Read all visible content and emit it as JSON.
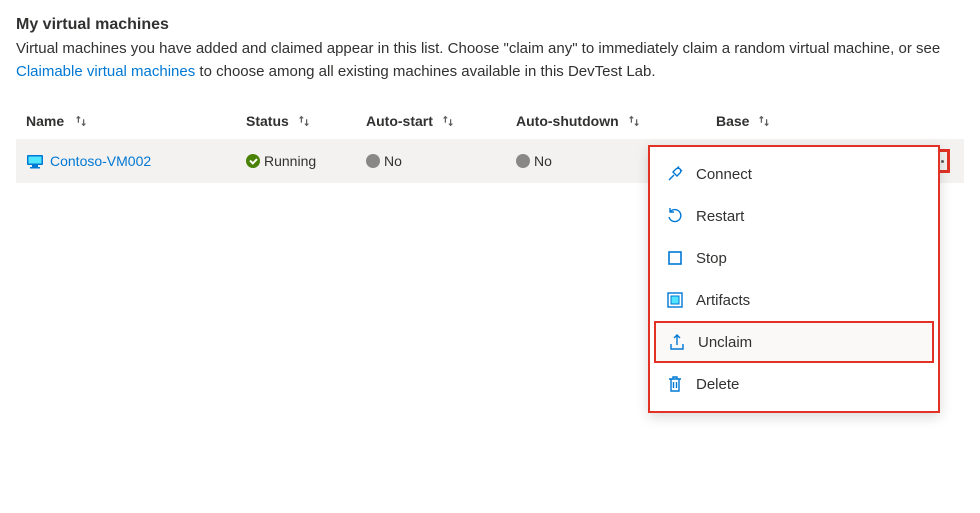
{
  "header": {
    "title": "My virtual machines",
    "description_before": "Virtual machines you have added and claimed appear in this list. Choose \"claim any\" to immediately claim a random virtual machine, or see ",
    "link_text": "Claimable virtual machines",
    "description_after": " to choose among all existing machines available in this DevTest Lab."
  },
  "columns": {
    "name": "Name",
    "status": "Status",
    "autostart": "Auto-start",
    "autoshutdown": "Auto-shutdown",
    "base": "Base"
  },
  "row": {
    "name": "Contoso-VM002",
    "status": "Running",
    "autostart": "No",
    "autoshutdown": "No",
    "base": ""
  },
  "menu": {
    "connect": "Connect",
    "restart": "Restart",
    "stop": "Stop",
    "artifacts": "Artifacts",
    "unclaim": "Unclaim",
    "delete": "Delete"
  }
}
